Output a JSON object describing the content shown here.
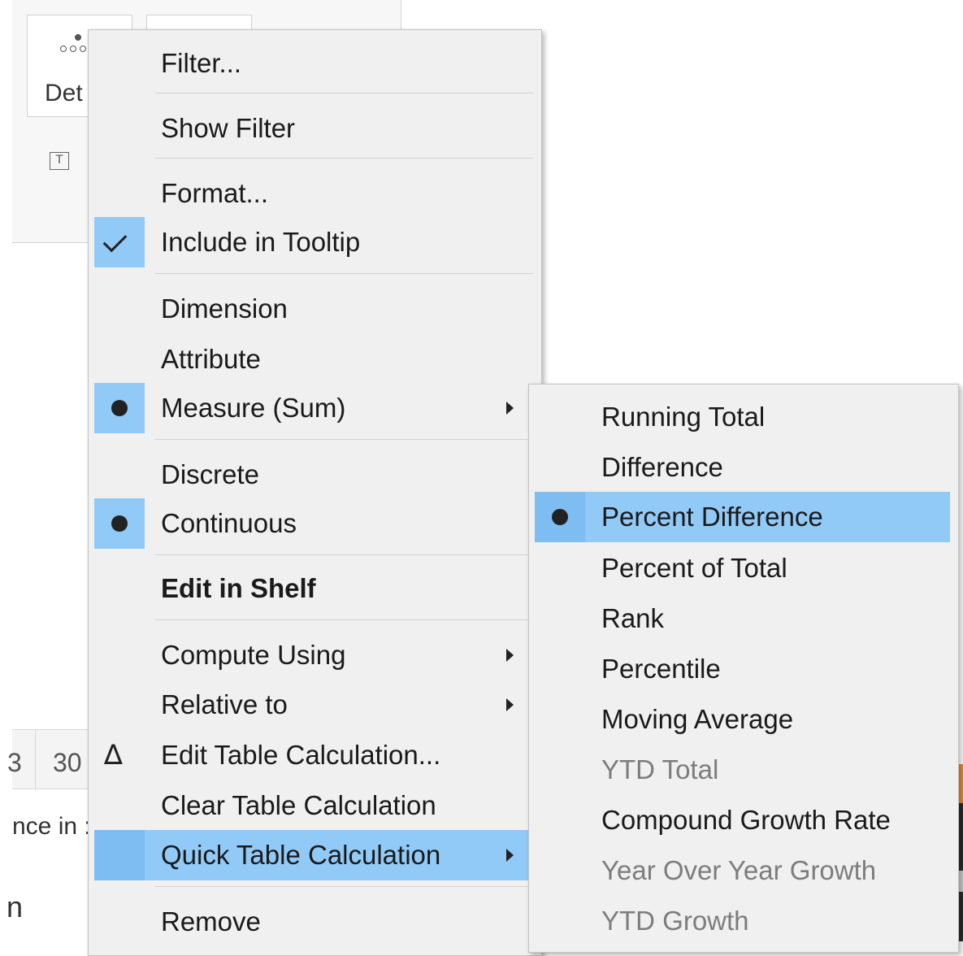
{
  "background": {
    "detail_label": "Det",
    "text_icon": "T",
    "cell_a": "3",
    "cell_b": "30",
    "status_fragment": "nce in :",
    "bottom_fragment": "n"
  },
  "main_menu": {
    "filter": "Filter...",
    "show_filter": "Show Filter",
    "format": "Format...",
    "include_in_tooltip": "Include in Tooltip",
    "dimension": "Dimension",
    "attribute": "Attribute",
    "measure_sum": "Measure (Sum)",
    "discrete": "Discrete",
    "continuous": "Continuous",
    "edit_in_shelf": "Edit in Shelf",
    "compute_using": "Compute Using",
    "relative_to": "Relative to",
    "edit_table_calculation": "Edit Table Calculation...",
    "clear_table_calculation": "Clear Table Calculation",
    "quick_table_calculation": "Quick Table Calculation",
    "remove": "Remove"
  },
  "sub_menu": {
    "running_total": "Running Total",
    "difference": "Difference",
    "percent_difference": "Percent Difference",
    "percent_of_total": "Percent of Total",
    "rank": "Rank",
    "percentile": "Percentile",
    "moving_average": "Moving Average",
    "ytd_total": "YTD Total",
    "compound_growth_rate": "Compound Growth Rate",
    "year_over_year_growth": "Year Over Year Growth",
    "ytd_growth": "YTD Growth"
  },
  "icons": {
    "check": "check-icon",
    "radio": "radio-dot-icon",
    "delta": "delta-icon",
    "submenu": "submenu-arrow-icon"
  },
  "colors": {
    "menu_bg": "#f0f0f0",
    "highlight": "#91c9f7",
    "disabled_text": "#7d7d7d"
  }
}
